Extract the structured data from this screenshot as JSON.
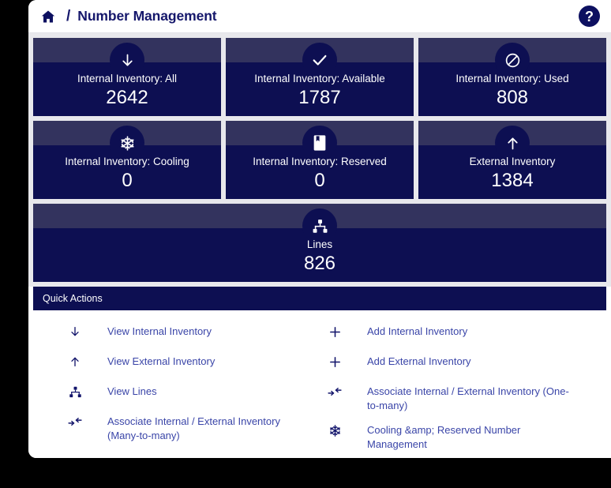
{
  "header": {
    "home_icon": "home-icon",
    "separator": "/",
    "title": "Number Management",
    "help_icon": "?"
  },
  "tiles": [
    {
      "icon": "arrow-down-icon",
      "label": "Internal Inventory: All",
      "value": "2642"
    },
    {
      "icon": "check-icon",
      "label": "Internal Inventory: Available",
      "value": "1787"
    },
    {
      "icon": "ban-icon",
      "label": "Internal Inventory: Used",
      "value": "808"
    },
    {
      "icon": "snowflake-icon",
      "label": "Internal Inventory: Cooling",
      "value": "0"
    },
    {
      "icon": "bookmark-icon",
      "label": "Internal Inventory: Reserved",
      "value": "0"
    },
    {
      "icon": "arrow-up-icon",
      "label": "External Inventory",
      "value": "1384"
    },
    {
      "icon": "sitemap-icon",
      "label": "Lines",
      "value": "826"
    }
  ],
  "quick_actions": {
    "title": "Quick Actions",
    "left": [
      {
        "icon": "arrow-down-icon",
        "label": "View Internal Inventory"
      },
      {
        "icon": "arrow-up-icon",
        "label": "View External Inventory"
      },
      {
        "icon": "sitemap-icon",
        "label": "View Lines"
      },
      {
        "icon": "associate-icon",
        "label": "Associate Internal / External Inventory (Many-to-many)"
      }
    ],
    "right": [
      {
        "icon": "plus-icon",
        "label": "Add Internal Inventory"
      },
      {
        "icon": "plus-icon",
        "label": "Add External Inventory"
      },
      {
        "icon": "associate-icon",
        "label": "Associate Internal / External Inventory (One-to-many)"
      },
      {
        "icon": "snowflake-icon",
        "label": "Cooling &amp; Reserved Number Management"
      }
    ]
  },
  "colors": {
    "tile_body": "#0d0f52",
    "tile_head": "#33335e",
    "brand_navy": "#15176b",
    "link_blue": "#3a45a8",
    "gap_gray": "#e8e8ec",
    "page_bg": "#000000"
  }
}
